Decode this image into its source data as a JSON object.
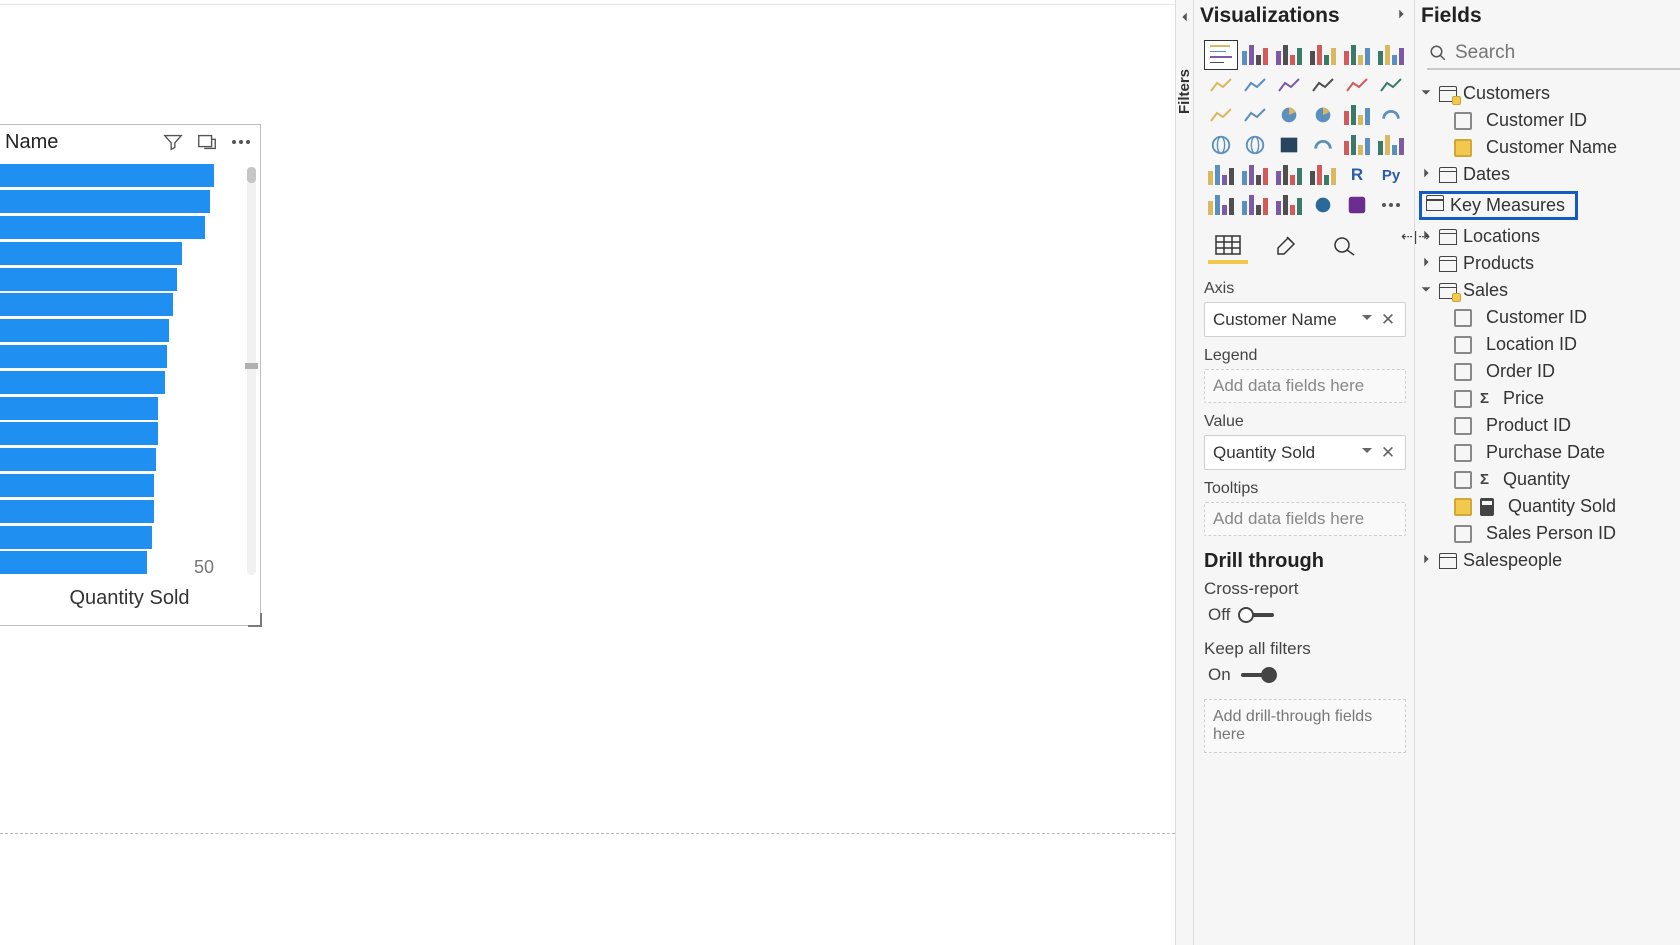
{
  "canvas": {
    "visual_title": "Name",
    "xlabel": "Quantity Sold",
    "tick": "50"
  },
  "chart_data": {
    "type": "bar",
    "orientation": "horizontal",
    "xlabel": "Quantity Sold",
    "ylabel": "Customer Name",
    "tick_visible": 50,
    "values_relative_pct": [
      100,
      98,
      96,
      85,
      83,
      81,
      79,
      78,
      77,
      74,
      74,
      73,
      72,
      72,
      71,
      69
    ]
  },
  "panes": {
    "filters_label": "Filters",
    "viz_title": "Visualizations",
    "fields_title": "Fields"
  },
  "viz_icons": [
    [
      "bar-h",
      "bar-v",
      "bar-stack-v",
      "bar-group-v",
      "bar-stack-h",
      "bar-group-h"
    ],
    [
      "line",
      "area",
      "area-stack",
      "combo",
      "combo2",
      "ribbon"
    ],
    [
      "waterfall",
      "scatter",
      "pie",
      "donut",
      "tree",
      "gauge"
    ],
    [
      "globe",
      "filled-map",
      "choropleth",
      "gauge2",
      "card",
      "kpi"
    ],
    [
      "multi-card",
      "funnel",
      "table",
      "matrix",
      "r",
      "py"
    ],
    [
      "key-influencers",
      "decomp",
      "qna",
      "paginated",
      "powerapps",
      "more"
    ]
  ],
  "wells": {
    "axis_label": "Axis",
    "axis_value": "Customer Name",
    "legend_label": "Legend",
    "legend_placeholder": "Add data fields here",
    "value_label": "Value",
    "value_value": "Quantity Sold",
    "tooltips_label": "Tooltips",
    "tooltips_placeholder": "Add data fields here"
  },
  "drill": {
    "header": "Drill through",
    "cross_label": "Cross-report",
    "cross_state": "Off",
    "keep_label": "Keep all filters",
    "keep_state": "On",
    "placeholder": "Add drill-through fields here"
  },
  "fields": {
    "search_placeholder": "Search",
    "tables": {
      "customers": {
        "name": "Customers",
        "items": [
          {
            "name": "Customer ID",
            "checked": false
          },
          {
            "name": "Customer Name",
            "checked": true
          }
        ]
      },
      "dates": {
        "name": "Dates"
      },
      "key_measures": {
        "name": "Key Measures"
      },
      "locations": {
        "name": "Locations"
      },
      "products": {
        "name": "Products"
      },
      "sales": {
        "name": "Sales",
        "items": [
          {
            "name": "Customer ID",
            "checked": false
          },
          {
            "name": "Location ID",
            "checked": false
          },
          {
            "name": "Order ID",
            "checked": false
          },
          {
            "name": "Price",
            "checked": false,
            "sigma": true
          },
          {
            "name": "Product ID",
            "checked": false
          },
          {
            "name": "Purchase Date",
            "checked": false
          },
          {
            "name": "Quantity",
            "checked": false,
            "sigma": true
          },
          {
            "name": "Quantity Sold",
            "checked": true,
            "calc": true
          },
          {
            "name": "Sales Person ID",
            "checked": false
          }
        ]
      },
      "salespeople": {
        "name": "Salespeople"
      }
    }
  }
}
